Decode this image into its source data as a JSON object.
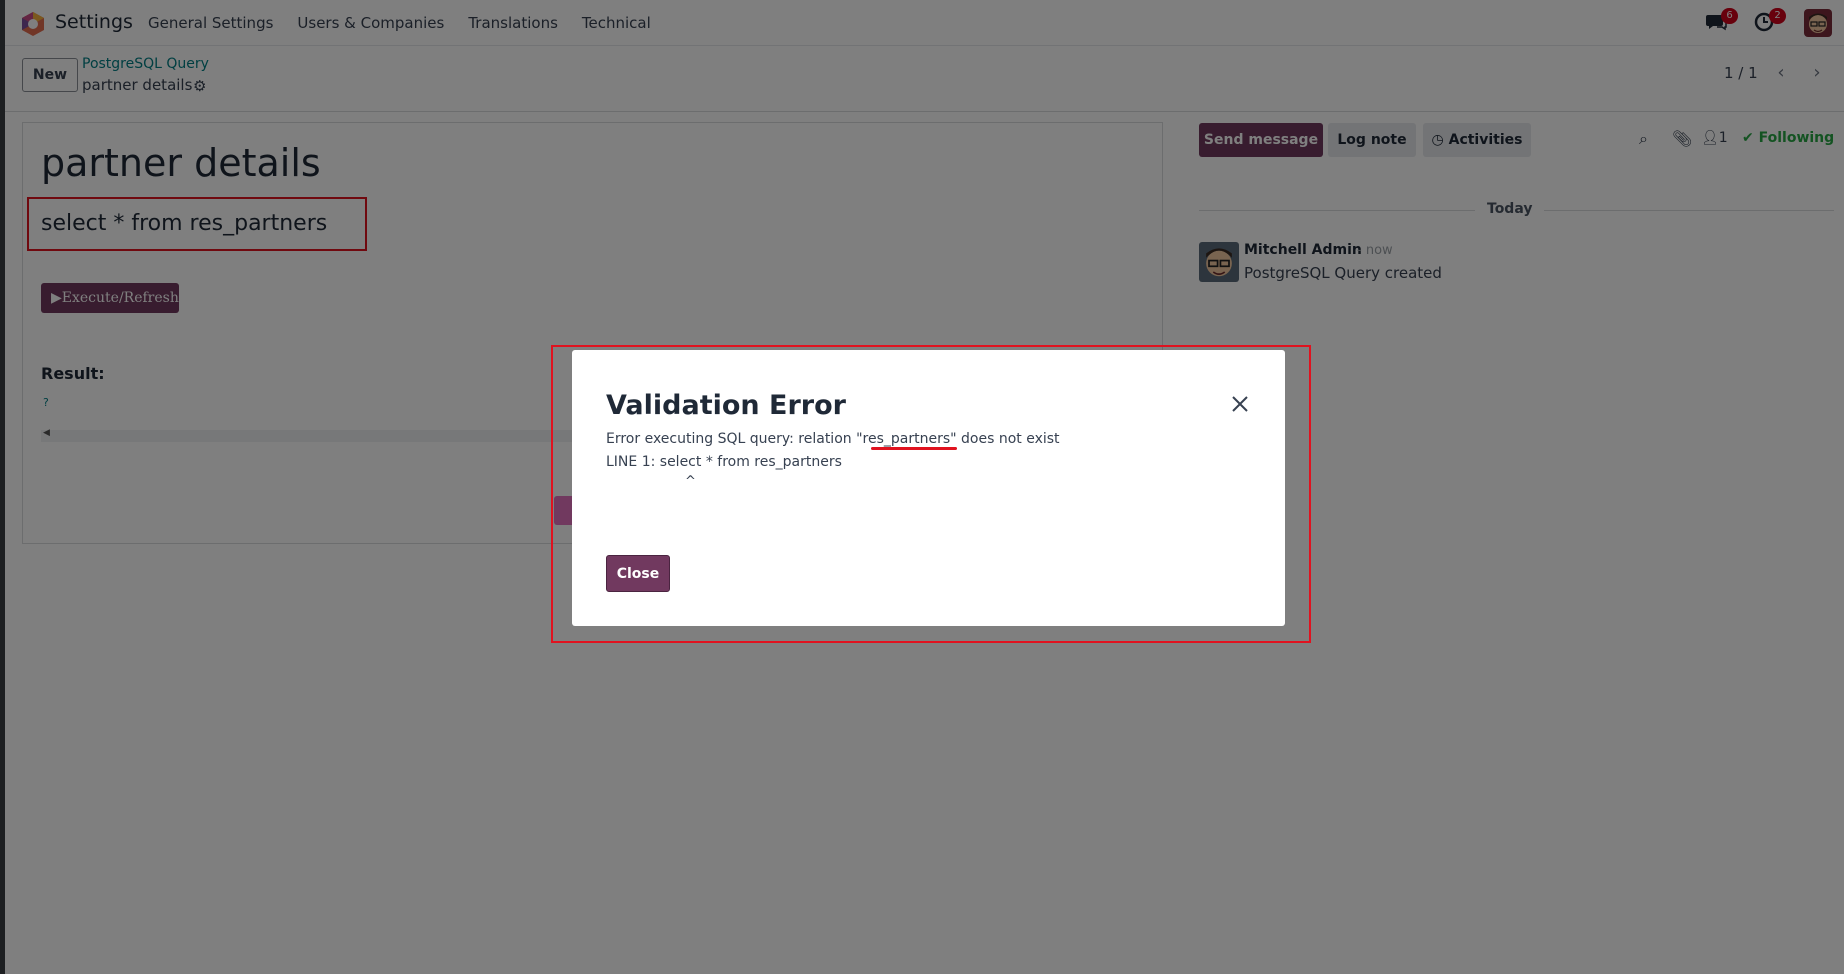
{
  "navbar": {
    "app_name": "Settings",
    "menu": [
      "General Settings",
      "Users & Companies",
      "Translations",
      "Technical"
    ],
    "messages_count": "6",
    "activities_count": "2"
  },
  "control_panel": {
    "new_label": "New",
    "breadcrumb_parent": "PostgreSQL Query",
    "breadcrumb_current": "partner details",
    "pager_value": "1 / 1"
  },
  "form": {
    "title": "partner details",
    "query": "select * from res_partners",
    "execute_label": "Execute/Refresh",
    "result_label": "Result:",
    "result_placeholder": "?"
  },
  "chatter": {
    "send_message": "Send message",
    "log_note": "Log note",
    "activities": "Activities",
    "followers_count": "1",
    "following": "Following",
    "date_separator": "Today",
    "message": {
      "author": "Mitchell Admin",
      "date": "- now",
      "body": "PostgreSQL Query created"
    }
  },
  "dialog": {
    "title": "Validation Error",
    "message_line1": "Error executing SQL query: relation \"res_partners\" does not exist",
    "message_line2": "LINE 1: select * from res_partners",
    "message_line3": "^",
    "close_label": "Close"
  },
  "colors": {
    "brand": "#71395f",
    "link": "#017e84",
    "following": "#28a745",
    "annotation": "#e0121f"
  }
}
